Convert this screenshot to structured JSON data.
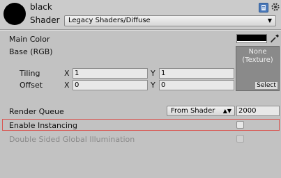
{
  "material": {
    "name": "black",
    "shader_label": "Shader",
    "shader_value": "Legacy Shaders/Diffuse",
    "icons": [
      "book-icon",
      "gear-icon"
    ]
  },
  "properties": {
    "main_color_label": "Main Color",
    "main_color_value": "#000000",
    "base_label": "Base (RGB)",
    "texture_slot_text": "None\n(Texture)",
    "texture_select_label": "Select",
    "tiling_label": "Tiling",
    "tiling_x_axis": "X",
    "tiling_x": "1",
    "tiling_y_axis": "Y",
    "tiling_y": "1",
    "offset_label": "Offset",
    "offset_x_axis": "X",
    "offset_x": "0",
    "offset_y_axis": "Y",
    "offset_y": "0"
  },
  "render": {
    "queue_label": "Render Queue",
    "queue_mode": "From Shader",
    "queue_value": "2000",
    "instancing_label": "Enable Instancing",
    "instancing_checked": false,
    "double_sided_label": "Double Sided Global Illumination",
    "double_sided_checked": false
  }
}
